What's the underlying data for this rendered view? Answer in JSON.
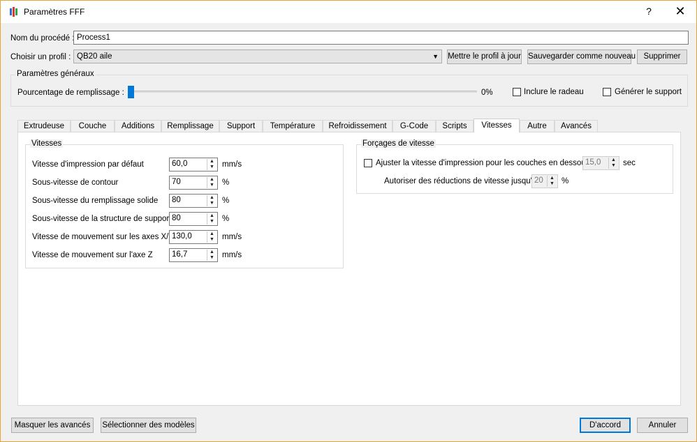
{
  "window": {
    "title": "Paramètres FFF",
    "help": "?",
    "close": "✕"
  },
  "process": {
    "label": "Nom du procédé :",
    "value": "Process1"
  },
  "profile": {
    "label": "Choisir un profil :",
    "value": "QB20 aile",
    "update_button": "Mettre le profil à jour",
    "save_new_button": "Sauvegarder comme nouveau",
    "delete_button": "Supprimer"
  },
  "general": {
    "title": "Paramètres généraux",
    "fill_label": "Pourcentage de remplissage :",
    "fill_value": "0%",
    "fill_fraction": 0,
    "raft_label": "Inclure le radeau",
    "support_label": "Générer le support"
  },
  "tabs": [
    "Extrudeuse",
    "Couche",
    "Additions",
    "Remplissage",
    "Support",
    "Température",
    "Refroidissement",
    "G-Code",
    "Scripts",
    "Vitesses",
    "Autre",
    "Avancés"
  ],
  "active_tab": "Vitesses",
  "speeds": {
    "title": "Vitesses",
    "rows": [
      {
        "label": "Vitesse d'impression par défaut",
        "value": "60,0",
        "unit": "mm/s"
      },
      {
        "label": "Sous-vitesse de contour",
        "value": "70",
        "unit": "%"
      },
      {
        "label": "Sous-vitesse du remplissage solide",
        "value": "80",
        "unit": "%"
      },
      {
        "label": "Sous-vitesse de la structure de support",
        "value": "80",
        "unit": "%"
      },
      {
        "label": "Vitesse de mouvement sur les axes X/Y",
        "value": "130,0",
        "unit": "mm/s"
      },
      {
        "label": "Vitesse de mouvement sur l'axe Z",
        "value": "16,7",
        "unit": "mm/s"
      }
    ]
  },
  "override": {
    "title": "Forçages de vitesse",
    "adjust_label": "Ajuster la vitesse d'impression pour les couches en dessous",
    "adjust_value": "15,0",
    "adjust_unit": "sec",
    "allow_label": "Autoriser des réductions de vitesse jusqu'à",
    "allow_value": "20",
    "allow_unit": "%"
  },
  "footer": {
    "hide_advanced": "Masquer les avancés",
    "select_models": "Sélectionner des modèles",
    "ok": "D'accord",
    "cancel": "Annuler"
  },
  "colors": {
    "accent": "#0078d7",
    "border": "#e8a33d"
  },
  "icons": {
    "spin_up": "▲",
    "spin_down": "▼",
    "combo": "▼"
  }
}
